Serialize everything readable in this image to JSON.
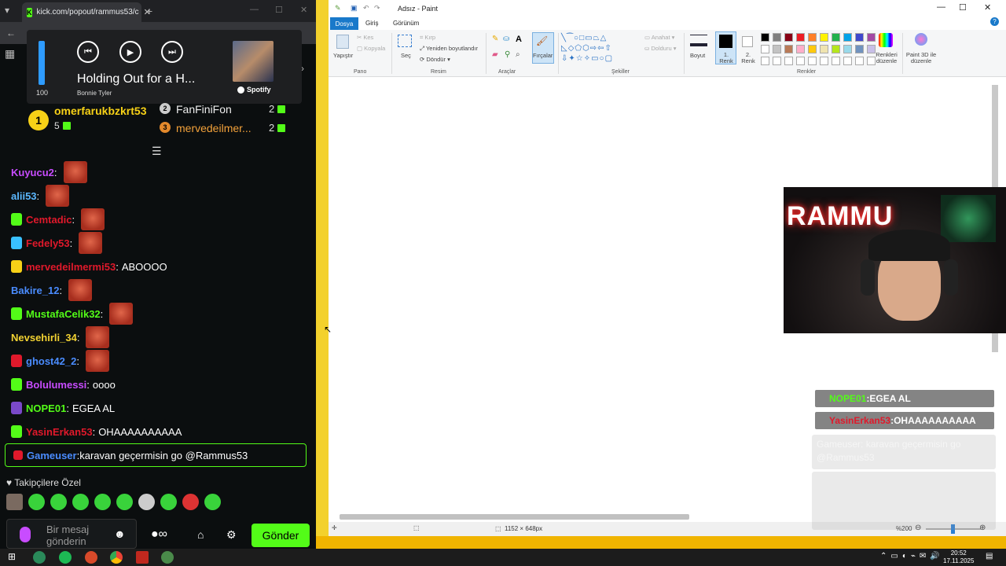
{
  "kick": {
    "tab_title": "kick.com/popout/rammus53/c",
    "spotify": {
      "volume": "100",
      "volume_level": 1.0,
      "track": "Holding Out for a H...",
      "artist": "Bonnie Tyler",
      "brand": "Spotify"
    },
    "leaderboard": [
      {
        "rank": "1",
        "name": "omerfarukbzkrt53",
        "count": "5"
      },
      {
        "rank": "2",
        "name": "FanFiniFon",
        "count": "2"
      },
      {
        "rank": "3",
        "name": "mervedeilmer...",
        "count": "2"
      }
    ],
    "messages": [
      {
        "user": "Kuyucu2",
        "text": "",
        "color": "#c84cff"
      },
      {
        "user": "alii53",
        "text": "",
        "color": "#5bb8ff"
      },
      {
        "user": "Cemtadic",
        "text": "",
        "color": "#e0192b"
      },
      {
        "user": "Fedely53",
        "text": "",
        "color": "#e0192b"
      },
      {
        "user": "mervedeilmermi53",
        "text": "ABOOOO",
        "color": "#e0192b"
      },
      {
        "user": "Bakire_12",
        "text": "",
        "color": "#4a8cff"
      },
      {
        "user": "MustafaCelik32",
        "text": "",
        "color": "#53fc18"
      },
      {
        "user": "Nevsehirli_34",
        "text": "",
        "color": "#f2d232"
      },
      {
        "user": "ghost42_2",
        "text": "",
        "color": "#4a8cff"
      },
      {
        "user": "Bolulumessi",
        "text": "oooo",
        "color": "#c84cff"
      },
      {
        "user": "NOPE01",
        "text": "EGEA AL",
        "color": "#53fc18"
      },
      {
        "user": "YasinErkan53",
        "text": "OHAAAAAAAAAA",
        "color": "#e0192b"
      }
    ],
    "highlight": {
      "user": "Gameuser",
      "text": "karavan geçermisin go @Rammus53",
      "color": "#4a8cff"
    },
    "followers_only": "Takipçilere Özel",
    "input_placeholder": "Bir mesaj gönderin",
    "send_label": "Gönder"
  },
  "paint": {
    "title": "Adsız - Paint",
    "tabs": [
      "Dosya",
      "Giriş",
      "Görünüm"
    ],
    "clipboard": {
      "paste": "Yapıştır",
      "cut": "Kes",
      "copy": "Kopyala",
      "group": "Pano"
    },
    "image": {
      "select": "Seç",
      "crop": "Kırp",
      "resize": "Yeniden boyutlandır",
      "rotate": "Döndür",
      "group": "Resim"
    },
    "tools_group": "Araçlar",
    "brushes": "Fırçalar",
    "shapes": {
      "outline": "Anahat",
      "fill": "Dolduru",
      "group": "Şekiller"
    },
    "size": "Boyut",
    "color1": "1. Renk",
    "color2": "2. Renk",
    "colors_group": "Renkler",
    "edit_colors": "Renkleri düzenle",
    "paint3d": "Paint 3D ile düzenle",
    "canvas_size": "1152 × 648px",
    "zoom": "%200",
    "palette": [
      "#000000",
      "#7f7f7f",
      "#880015",
      "#ed1c24",
      "#ff7f27",
      "#fff200",
      "#22b14c",
      "#00a2e8",
      "#3f48cc",
      "#a349a4",
      "#ffffff",
      "#c3c3c3",
      "#b97a57",
      "#ffaec9",
      "#ffc90e",
      "#efe4b0",
      "#b5e61d",
      "#99d9ea",
      "#7092be",
      "#c8bfe7"
    ]
  },
  "webcam": {
    "neon": "RAMMU"
  },
  "overlay": {
    "messages": [
      {
        "user": "NOPE01",
        "text": "EGEA AL",
        "color": "#53fc18"
      },
      {
        "user": "YasinErkan53",
        "text": "OHAAAAAAAAAA",
        "color": "#e0192b"
      }
    ],
    "faded": [
      {
        "user": "Gameuser",
        "text": "karavan geçermisin go @Rammus53"
      }
    ]
  },
  "taskbar": {
    "time": "20:52",
    "date": "17.11.2025"
  }
}
